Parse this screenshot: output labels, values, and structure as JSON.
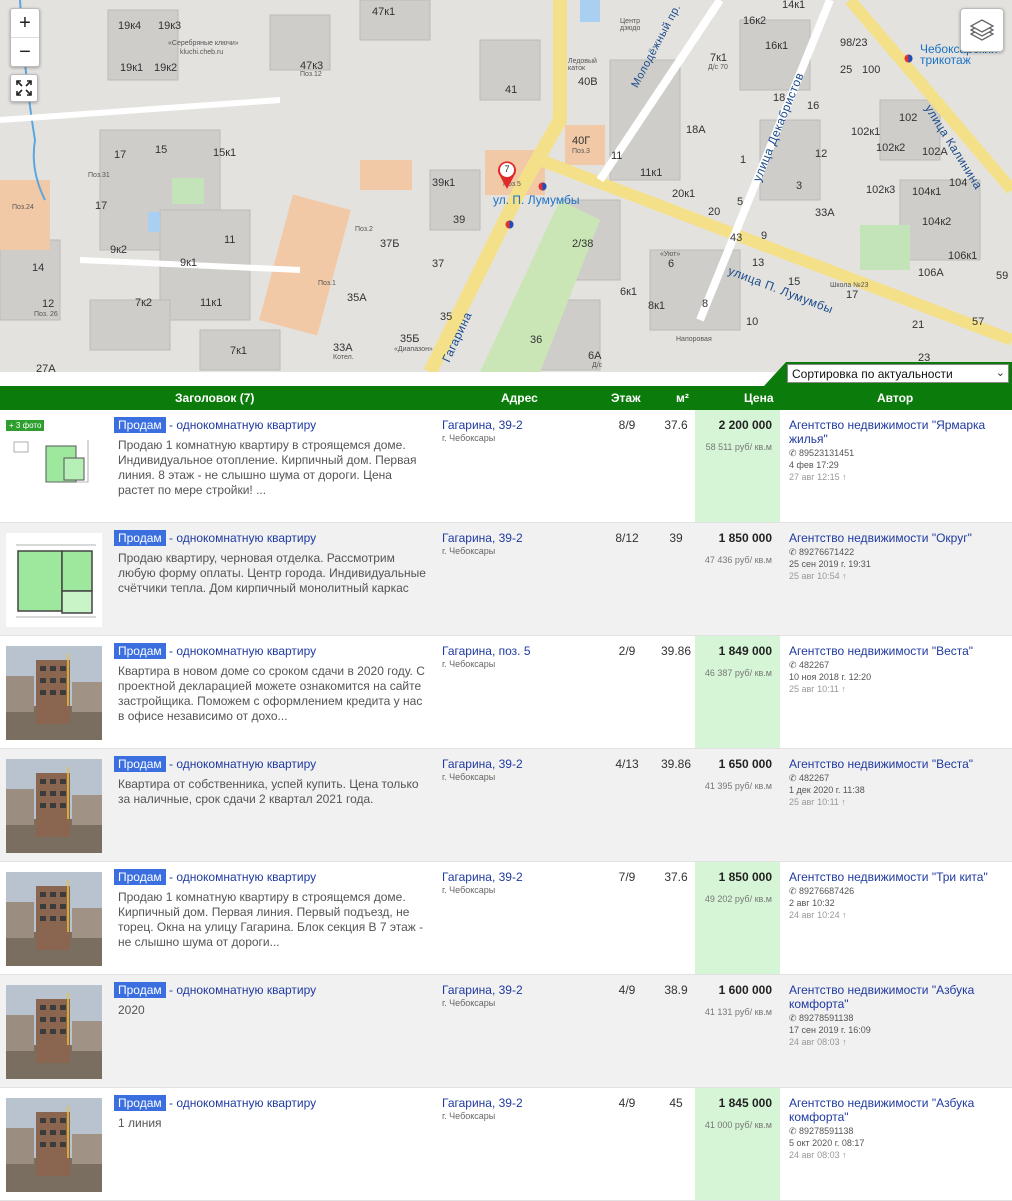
{
  "map": {
    "zoom_in": "+",
    "zoom_out": "−",
    "labels": {
      "b_19k4": "19к4",
      "b_19k3": "19к3",
      "b_19k1": "19к1",
      "b_19k2": "19к2",
      "serebr": "«Серебряные ключи»",
      "serebr_url": "kluchi.cheb.ru",
      "b_47k3": "47к3",
      "poz12": "Поз.12",
      "b_47k1": "47к1",
      "b_41": "41",
      "center_dzyudo": "Центр дзюдо",
      "ledovy": "Ледовый каток",
      "b_40v": "40В",
      "b_40g": "40Г",
      "poz3": "Поз.3",
      "b_7k1": "7к1",
      "ds70": "Д/с 70",
      "b_16k2": "16к2",
      "b_16k1": "16к1",
      "b_98_23": "98/23",
      "b_25": "25",
      "b_100": "100",
      "b_14k1": "14к1",
      "metro_trikotazh": "Чебоксарский трикотаж",
      "kalinina": "улица Калинина",
      "molodezh": "Молодёжный пр.",
      "dekabristov": "улица Декабристов",
      "lumumby_stop": "ул. П. Лумумбы",
      "lumumby_street": "улица П. Лумумбы",
      "gagarina": "Гагарина",
      "b_17": "17",
      "b_15": "15",
      "b_15k1": "15к1",
      "poz31": "Поз.31",
      "poz24": "Поз.24",
      "b_17b": "17",
      "b_11": "11",
      "b_9k2": "9к2",
      "b_9k1": "9к1",
      "b_14": "14",
      "b_7k2": "7к2",
      "b_11k1": "11к1",
      "b_12": "12",
      "poz26": "Поз. 26",
      "b_7k1b": "7к1",
      "b_27a": "27А",
      "b_39k1": "39к1",
      "poz5": "Поз.5",
      "b_39": "39",
      "poz2": "Поз.2",
      "b_37b": "37Б",
      "b_37": "37",
      "poz1": "Поз.1",
      "b_35a": "35А",
      "b_35": "35",
      "b_35b": "35Б",
      "diapazon": "«Диапазон»",
      "b_33a": "33А",
      "kotel": "Котел.",
      "b_36": "36",
      "b_2_38": "2/38",
      "b_11b": "11",
      "b_11k1b": "11к1",
      "b_6": "6",
      "uyut": "«Уют»",
      "b_6k1": "6к1",
      "b_8k1": "8к1",
      "b_8": "8",
      "b_10": "10",
      "b_6a": "6А",
      "ds_kot": "Д/с",
      "b_18a": "18А",
      "b_20k1": "20к1",
      "b_20": "20",
      "b_43": "43",
      "b_13": "13",
      "b_15b": "15",
      "b_18": "18",
      "b_102": "102",
      "b_102k1": "102к1",
      "b_102k2": "102к2",
      "b_102a": "102А",
      "b_104": "104",
      "b_102k3": "102к3",
      "b_104k1": "104к1",
      "b_104k2": "104к2",
      "b_106k1": "106к1",
      "b_106a": "106А",
      "b_33a2": "33А",
      "b_17c": "17",
      "b_21": "21",
      "b_23": "23",
      "b_57": "57",
      "b_59": "59",
      "shkola": "Школа №23",
      "napor": "Напоровая",
      "b_16": "16",
      "b_12b": "12",
      "b_1": "1",
      "b_3": "3",
      "b_9": "9",
      "b_5": "5"
    },
    "marker_count": "7"
  },
  "sort": {
    "selected": "Сортировка по актуальности"
  },
  "table": {
    "headers": {
      "title": "Заголовок (7)",
      "address": "Адрес",
      "floor": "Этаж",
      "area": "м²",
      "price": "Цена",
      "author": "Автор"
    },
    "rows": [
      {
        "photo_badge": "+ 3 фото",
        "deal": "Продам",
        "type": "- однокомнатную квартиру",
        "desc": "Продаю 1 комнатную квартиру в строящемся доме. Индивидуальное отопление. Кирпичный дом. Первая линия. 8 этаж - не слышно шума от дороги. Цена растет по мере стройки! ...",
        "address": "Гагарина, 39-2",
        "city": "г. Чебоксары",
        "floor": "8/9",
        "area": "37.6",
        "price": "2 200 000",
        "ppm": "58 511 руб/ кв.м",
        "highlight": true,
        "agent": "Агентство недвижимости \"Ярмарка жилья\"",
        "phone": "89523131451",
        "date1": "4 фев 17:29",
        "date2": "27 авг 12:15 ↑"
      },
      {
        "photo_badge": "",
        "deal": "Продам",
        "type": "- однокомнатную квартиру",
        "desc": "Продаю квартиру, черновая отделка. Рассмотрим любую форму оплаты. Центр города. Индивидуальные счётчики тепла. Дом кирпичный монолитный каркас",
        "address": "Гагарина, 39-2",
        "city": "г. Чебоксары",
        "floor": "8/12",
        "area": "39",
        "price": "1 850 000",
        "ppm": "47 436 руб/ кв.м",
        "highlight": false,
        "agent": "Агентство недвижимости \"Округ\"",
        "phone": "89276671422",
        "date1": "25 сен 2019 г. 19:31",
        "date2": "25 авг 10:54 ↑"
      },
      {
        "photo_badge": "",
        "deal": "Продам",
        "type": "- однокомнатную квартиру",
        "desc": "Квартира в новом доме со сроком сдачи в 2020 году. С проектной декларацией можете ознакомится на сайте застройщика. Поможем с оформлением кредита у нас в офисе независимо от дохо...",
        "address": "Гагарина, поз. 5",
        "city": "г. Чебоксары",
        "floor": "2/9",
        "area": "39.86",
        "price": "1 849 000",
        "ppm": "46 387 руб/ кв.м",
        "highlight": true,
        "agent": "Агентство недвижимости \"Веста\"",
        "phone": "482267",
        "date1": "10 ноя 2018 г. 12:20",
        "date2": "25 авг 10:11 ↑"
      },
      {
        "photo_badge": "",
        "deal": "Продам",
        "type": "- однокомнатную квартиру",
        "desc": "Квартира от собственника, успей купить. Цена только за наличные, срок сдачи 2 квартал 2021 года.",
        "address": "Гагарина, 39-2",
        "city": "г. Чебоксары",
        "floor": "4/13",
        "area": "39.86",
        "price": "1 650 000",
        "ppm": "41 395 руб/ кв.м",
        "highlight": false,
        "agent": "Агентство недвижимости \"Веста\"",
        "phone": "482267",
        "date1": "1 дек 2020 г. 11:38",
        "date2": "25 авг 10:11 ↑"
      },
      {
        "photo_badge": "",
        "deal": "Продам",
        "type": "- однокомнатную квартиру",
        "desc": "Продаю 1 комнатную квартиру в строящемся доме. Кирпичный дом. Первая линия. Первый подъезд, не торец. Окна на улицу Гагарина. Блок секция В 7 этаж - не слышно шума от дороги...",
        "address": "Гагарина, 39-2",
        "city": "г. Чебоксары",
        "floor": "7/9",
        "area": "37.6",
        "price": "1 850 000",
        "ppm": "49 202 руб/ кв.м",
        "highlight": true,
        "agent": "Агентство недвижимости \"Три кита\"",
        "phone": "89276687426",
        "date1": "2 авг 10:32",
        "date2": "24 авг 10:24 ↑"
      },
      {
        "photo_badge": "",
        "deal": "Продам",
        "type": "- однокомнатную квартиру",
        "desc": "2020",
        "address": "Гагарина, 39-2",
        "city": "г. Чебоксары",
        "floor": "4/9",
        "area": "38.9",
        "price": "1 600 000",
        "ppm": "41 131 руб/ кв.м",
        "highlight": false,
        "agent": "Агентство недвижимости \"Азбука комфорта\"",
        "phone": "89278591138",
        "date1": "17 сен 2019 г. 16:09",
        "date2": "24 авг 08:03 ↑"
      },
      {
        "photo_badge": "",
        "deal": "Продам",
        "type": "- однокомнатную квартиру",
        "desc": "1 линия",
        "address": "Гагарина, 39-2",
        "city": "г. Чебоксары",
        "floor": "4/9",
        "area": "45",
        "price": "1 845 000",
        "ppm": "41 000 руб/ кв.м",
        "highlight": true,
        "agent": "Агентство недвижимости \"Азбука комфорта\"",
        "phone": "89278591138",
        "date1": "5 окт 2020 г. 08:17",
        "date2": "24 авг 08:03 ↑"
      }
    ]
  },
  "colors": {
    "header_green": "#0b7b0b",
    "price_highlight": "#d6f5d6",
    "link_blue": "#1f3aa0",
    "deal_badge": "#3b6fe0"
  }
}
